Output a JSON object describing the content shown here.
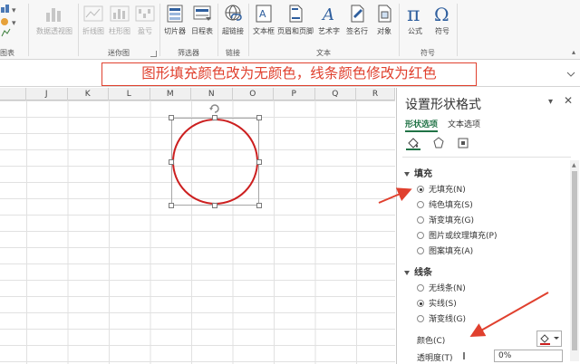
{
  "ribbon": {
    "groups": [
      {
        "label": "图表",
        "buttons": [
          {
            "label": ""
          }
        ]
      },
      {
        "label": "",
        "buttons": [
          {
            "label": "数据透视图"
          }
        ]
      },
      {
        "label": "迷你图",
        "buttons": [
          {
            "label": "折线图"
          },
          {
            "label": "柱形图"
          },
          {
            "label": "盈亏"
          }
        ]
      },
      {
        "label": "筛选器",
        "buttons": [
          {
            "label": "切片器"
          },
          {
            "label": "日程表"
          }
        ]
      },
      {
        "label": "链接",
        "buttons": [
          {
            "label": "超链接"
          }
        ]
      },
      {
        "label": "文本",
        "buttons": [
          {
            "label": "文本框"
          },
          {
            "label": "页眉和页脚"
          },
          {
            "label": "艺术字"
          },
          {
            "label": "签名行"
          },
          {
            "label": "对象"
          }
        ]
      },
      {
        "label": "符号",
        "buttons": [
          {
            "label": "公式"
          },
          {
            "label": "符号"
          }
        ]
      }
    ]
  },
  "annotation": {
    "text": "图形填充颜色改为无颜色，线条颜色修改为红色"
  },
  "columns": [
    "J",
    "K",
    "L",
    "M",
    "N",
    "O",
    "P",
    "Q",
    "R"
  ],
  "pane": {
    "title": "设置形状格式",
    "tabs": [
      {
        "label": "形状选项"
      },
      {
        "label": "文本选项"
      }
    ],
    "fill": {
      "title": "填充",
      "options": [
        {
          "label": "无填充(N)",
          "checked": true
        },
        {
          "label": "纯色填充(S)",
          "checked": false
        },
        {
          "label": "渐变填充(G)",
          "checked": false
        },
        {
          "label": "图片或纹理填充(P)",
          "checked": false
        },
        {
          "label": "图案填充(A)",
          "checked": false
        }
      ]
    },
    "line": {
      "title": "线条",
      "options": [
        {
          "label": "无线条(N)",
          "checked": false
        },
        {
          "label": "实线(S)",
          "checked": true
        },
        {
          "label": "渐变线(G)",
          "checked": false
        }
      ],
      "color_label": "颜色(C)",
      "opacity_label": "透明度(T)",
      "opacity_value": "0%"
    }
  },
  "colors": {
    "shape_outline": "#cc1f1f",
    "accent": "#217346",
    "annotation": "#e0402e"
  }
}
